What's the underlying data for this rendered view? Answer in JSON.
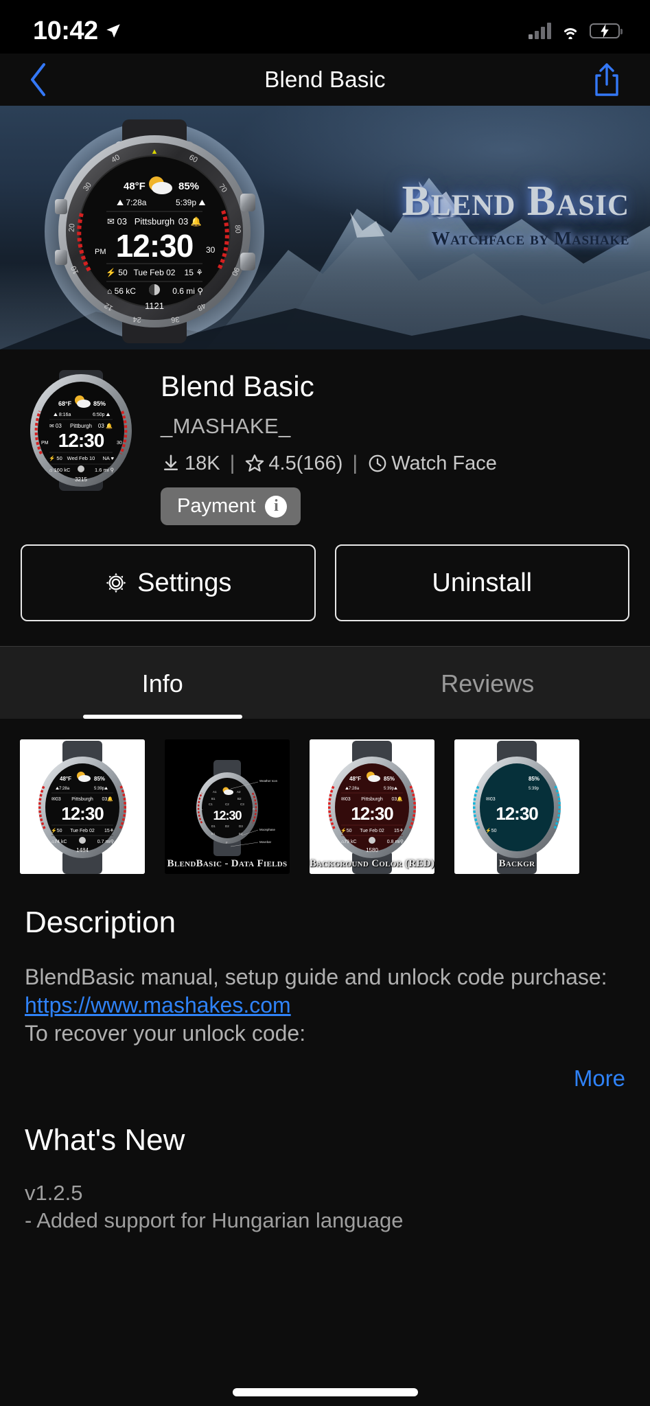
{
  "status_bar": {
    "time": "10:42",
    "location_icon": "location-arrow-icon",
    "signal_icon": "cellular-signal-icon",
    "wifi_icon": "wifi-icon",
    "battery_icon": "battery-charging-icon",
    "battery_color": "#4cd964"
  },
  "nav": {
    "back_icon": "chevron-left-icon",
    "title": "Blend Basic",
    "share_icon": "share-icon",
    "accent_color": "#3478f6"
  },
  "hero": {
    "title": "Blend Basic",
    "subtitle": "Watchface by Mashake",
    "glow_color": "#5e7ec4"
  },
  "app": {
    "name": "Blend Basic",
    "developer": "_MASHAKE_",
    "downloads": "18K",
    "downloads_icon": "download-icon",
    "rating": "4.5(166)",
    "rating_icon": "star-icon",
    "category": "Watch Face",
    "category_icon": "clock-icon",
    "separator": "|",
    "badge_label": "Payment",
    "badge_info_icon": "info-icon",
    "badge_info_glyph": "i"
  },
  "actions": {
    "settings_label": "Settings",
    "settings_icon": "gear-icon",
    "uninstall_label": "Uninstall"
  },
  "tabs": [
    {
      "label": "Info",
      "active": true
    },
    {
      "label": "Reviews",
      "active": false
    }
  ],
  "screenshots": [
    {
      "caption": "",
      "theme": "white",
      "watch_color": "#d8d8d8",
      "dial_color": "#141414",
      "accent": "#d32020",
      "steps": "1484",
      "temp": "48°F",
      "humidity": "85%",
      "sunrise": "7:28a",
      "sunset": "5:39p",
      "city": "Pittsburgh",
      "time": "12:30",
      "date": "Tue Feb 02"
    },
    {
      "caption": "BlendBasic - Data Fields",
      "theme": "black",
      "watch_color": "#b9b9b9",
      "dial_color": "#0a0a0a",
      "accent": "#c02020",
      "steps": "",
      "temp": "",
      "humidity": "",
      "sunrise": "",
      "sunset": "",
      "city": "",
      "time": "12:30",
      "date": ""
    },
    {
      "caption": "Background Color (RED)",
      "theme": "white",
      "watch_color": "#d8d8d8",
      "dial_color": "#3a0d0d",
      "accent": "#e02020",
      "steps": "1580",
      "temp": "48°F",
      "humidity": "85%",
      "sunrise": "7:28a",
      "sunset": "5:39p",
      "city": "Pittsburgh",
      "time": "12:30",
      "date": "Tue Feb 02"
    },
    {
      "caption": "Backgr",
      "theme": "white",
      "watch_color": "#d8d8d8",
      "dial_color": "#06303a",
      "accent": "#16b4d8",
      "steps": "",
      "temp": "",
      "humidity": "",
      "sunrise": "",
      "sunset": "",
      "city": "",
      "time": "1",
      "date": ""
    }
  ],
  "description": {
    "heading": "Description",
    "lines": [
      "BlendBasic manual, setup guide and unlock code purchase:"
    ],
    "link": "https://www.mashakes.com",
    "trailing_line": "To recover your unlock code:",
    "more_label": "More",
    "link_color": "#2f82f7"
  },
  "whats_new": {
    "heading": "What's New",
    "version": "v1.2.5",
    "note": "- Added support for Hungarian language"
  },
  "watch_face": {
    "temp": "48°F",
    "humidity": "85%",
    "sunrise": "7:28a",
    "sunset": "5:39p",
    "mail_count": "03",
    "city": "Pittsburgh",
    "alarm_count": "03",
    "time": "12:30",
    "battery": "50",
    "date": "Tue Feb 02",
    "right_val": "15",
    "calories": "56 kC",
    "distance": "0.6 mi",
    "steps": "1121",
    "minute_mark": "30",
    "ampm": "PM"
  },
  "app_icon_face": {
    "temp": "68°F",
    "humidity": "85%",
    "sunrise": "8:16a",
    "sunset": "6:50p",
    "mail_count": "03",
    "city": "Pittburgh",
    "alarm_count": "03",
    "time": "12:30",
    "battery": "50",
    "date": "Wed Feb 10",
    "right_val": "NA",
    "calories": "160 kC",
    "distance": "1.6 mi",
    "steps": "3215",
    "minute_mark": "30",
    "ampm": "PM"
  }
}
